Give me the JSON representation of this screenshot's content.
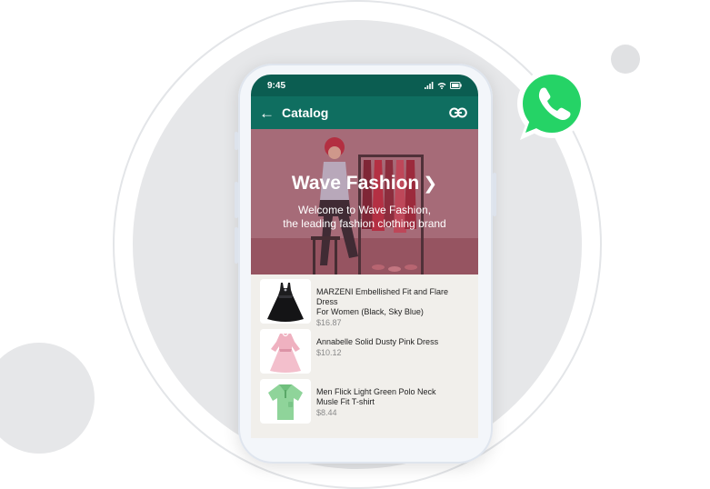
{
  "status": {
    "time": "9:45"
  },
  "appbar": {
    "title": "Catalog"
  },
  "hero": {
    "title": "Wave Fashion",
    "subtitle_line1": "Welcome to Wave Fashion,",
    "subtitle_line2": "the leading fashion clothing brand"
  },
  "products": [
    {
      "name_line1": "MARZENI Embellished Fit and Flare Dress",
      "name_line2": "For Women (Black, Sky Blue)",
      "price": "$16.87",
      "icon": "black-dress-icon"
    },
    {
      "name_line1": "Annabelle Solid Dusty Pink Dress",
      "name_line2": "",
      "price": "$10.12",
      "icon": "pink-dress-icon"
    },
    {
      "name_line1": "Men Flick Light Green Polo Neck",
      "name_line2": "Musle Fit T-shirt",
      "price": "$8.44",
      "icon": "green-polo-icon"
    }
  ],
  "colors": {
    "header": "#0f6e60",
    "statusbar": "#0b5d51",
    "whatsapp_green": "#25d366",
    "list_bg": "#f1efeb"
  }
}
